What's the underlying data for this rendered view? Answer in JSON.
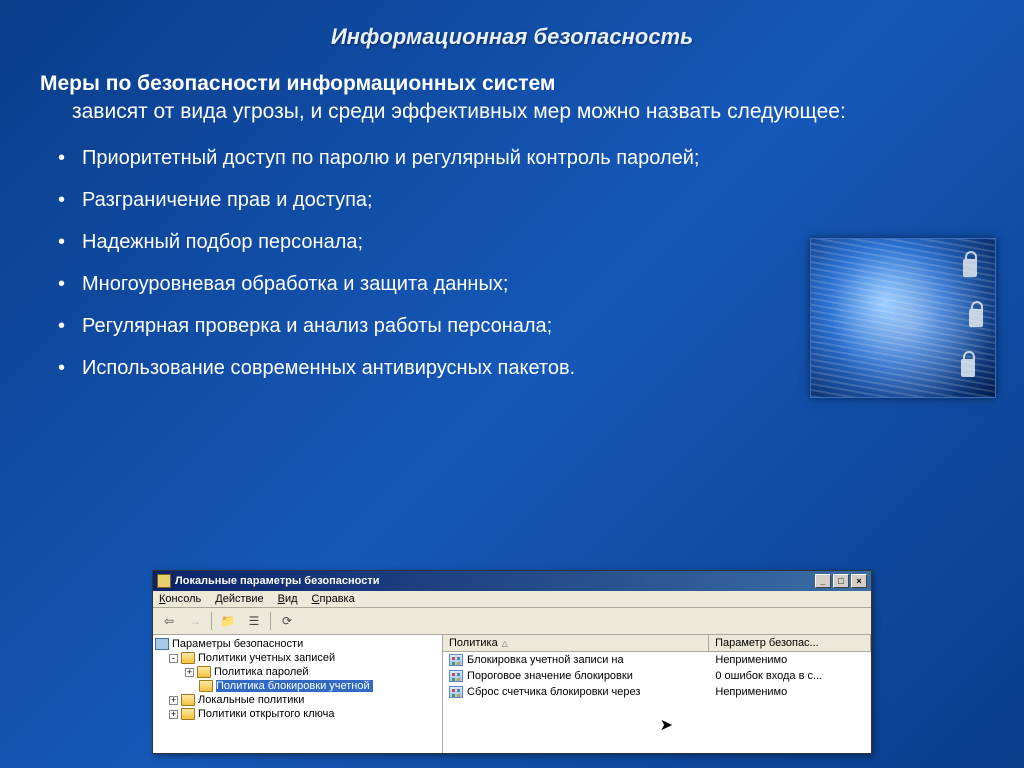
{
  "slide": {
    "title": "Информационная безопасность",
    "heading_bold": "Меры по безопасности информационных систем",
    "heading_rest": "зависят от вида угрозы, и среди эффективных мер можно назвать следующее:",
    "bullets": [
      "Приоритетный доступ по паролю и регулярный контроль паролей;",
      "Разграничение прав и доступа;",
      "Надежный подбор персонала;",
      "Многоуровневая обработка и защита данных;",
      "Регулярная проверка и анализ работы персонала;",
      "Использование современных антивирусных пакетов."
    ]
  },
  "side_image": {
    "alt": "digital-globe-with-padlocks"
  },
  "window": {
    "title": "Локальные параметры безопасности",
    "menu": [
      "Консоль",
      "Действие",
      "Вид",
      "Справка"
    ],
    "controls": {
      "min": "_",
      "max": "□",
      "close": "×"
    },
    "toolbar_icons": [
      "back-arrow",
      "forward-arrow",
      "up-folder",
      "properties",
      "divider",
      "refresh"
    ],
    "tree": {
      "root": "Параметры безопасности",
      "nodes": [
        {
          "label": "Политики учетных записей",
          "expand": "-",
          "children": [
            {
              "label": "Политика паролей",
              "expand": "+"
            },
            {
              "label": "Политика блокировки учетной",
              "expand": "",
              "selected": true
            }
          ]
        },
        {
          "label": "Локальные политики",
          "expand": "+"
        },
        {
          "label": "Политики открытого ключа",
          "expand": "+"
        }
      ]
    },
    "list": {
      "columns": [
        "Политика",
        "Параметр безопас..."
      ],
      "rows": [
        {
          "policy": "Блокировка учетной записи на",
          "param": "Неприменимо"
        },
        {
          "policy": "Пороговое значение блокировки",
          "param": "0 ошибок входа в с..."
        },
        {
          "policy": "Сброс счетчика блокировки через",
          "param": "Неприменимо"
        }
      ]
    }
  }
}
